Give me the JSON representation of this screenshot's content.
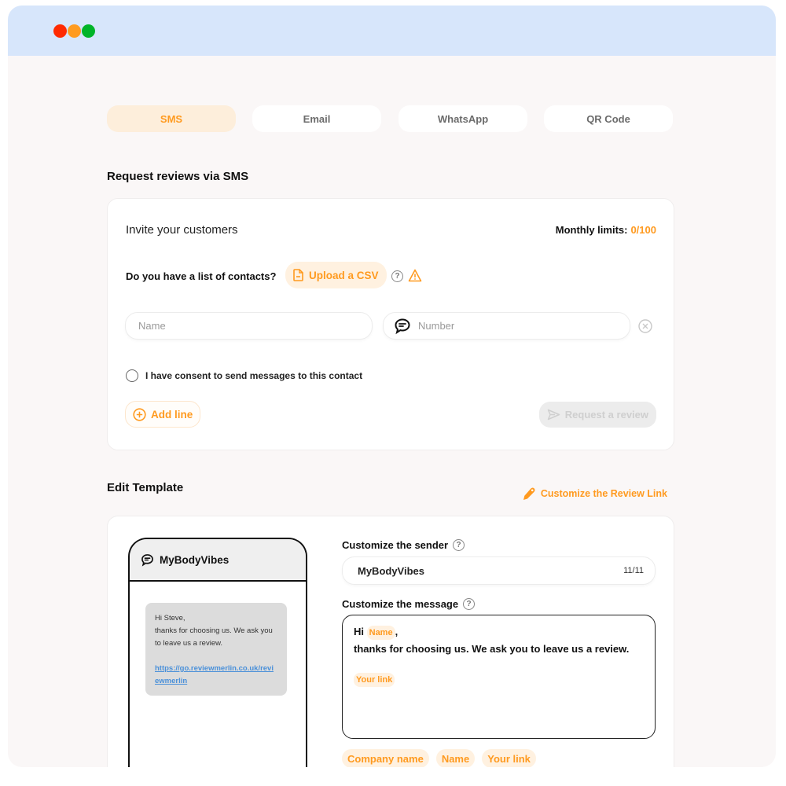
{
  "window": {
    "traffic_lights": [
      "close",
      "minimize",
      "maximize"
    ]
  },
  "tabs": [
    {
      "label": "SMS",
      "active": true
    },
    {
      "label": "Email",
      "active": false
    },
    {
      "label": "WhatsApp",
      "active": false
    },
    {
      "label": "QR Code",
      "active": false
    }
  ],
  "request_section": {
    "title": "Request reviews via SMS",
    "invite_label": "Invite your customers",
    "monthly_limits_label": "Monthly limits:",
    "monthly_limits_value": "0/100",
    "contacts_question": "Do you have a list of contacts?",
    "upload_csv_label": "Upload a CSV",
    "help_icon": "question-circle",
    "warning_icon": "warning-triangle",
    "name_placeholder": "Name",
    "name_value": "",
    "number_placeholder": "Number",
    "number_value": "",
    "consent_label": "I have consent to send messages to this contact",
    "consent_checked": false,
    "add_line_label": "Add line",
    "request_button_label": "Request a review",
    "request_button_enabled": false
  },
  "template_section": {
    "title": "Edit Template",
    "customize_link_label": "Customize the Review Link",
    "phone_preview": {
      "sender_name": "MyBodyVibes",
      "message_lines": [
        "Hi Steve,",
        "thanks for choosing us. We ask you to leave us a review."
      ],
      "link": "https://go.reviewmerlin.co.uk/reviewmerlin"
    },
    "sender_label": "Customize the sender",
    "sender_value": "MyBodyVibes",
    "sender_count": "11/11",
    "message_label": "Customize the message",
    "message": {
      "greeting": "Hi",
      "name_token": "Name",
      "comma": ",",
      "body": "thanks for choosing us. We ask you to leave us a review.",
      "link_token": "Your link"
    },
    "variable_chips": [
      "Company name",
      "Name",
      "Your link"
    ]
  },
  "colors": {
    "accent": "#ff9a1f",
    "accent_bg": "#fff1e0",
    "titlebar": "#d7e6fb",
    "page_bg": "#faf7f7",
    "link": "#4a90d9"
  }
}
